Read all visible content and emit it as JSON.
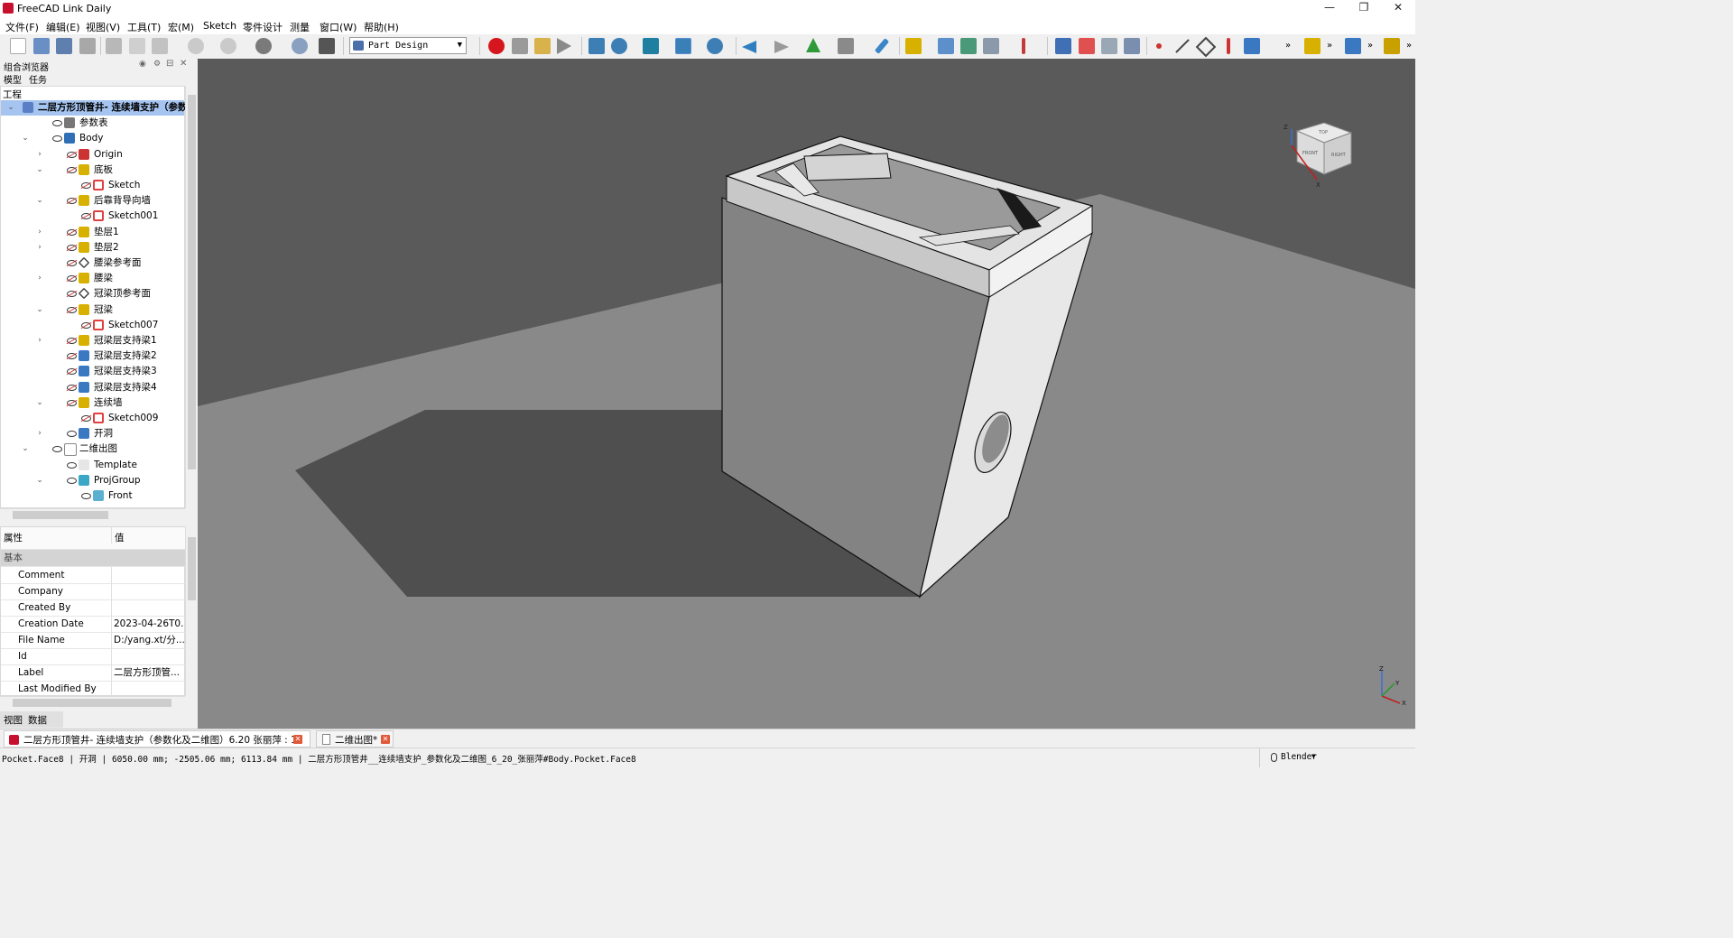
{
  "window": {
    "title": "FreeCAD Link Daily",
    "minimize": "—",
    "restore": "❐",
    "close": "✕"
  },
  "menu": [
    "文件(F)",
    "编辑(E)",
    "视图(V)",
    "工具(T)",
    "宏(M)",
    "Sketch",
    "零件设计",
    "测量",
    "窗口(W)",
    "帮助(H)"
  ],
  "toolbar": {
    "workbench": "Part Design",
    "overflow": "»"
  },
  "left_panel": {
    "title": "组合浏览器",
    "tabs": [
      "模型",
      "任务"
    ],
    "section": "工程",
    "tree": [
      {
        "label": "二层方形顶管井- 连续墙支护（参数化及二维图）",
        "depth": 0,
        "exp": "v",
        "eye": "",
        "icon": "doc",
        "selected": true
      },
      {
        "label": "参数表",
        "depth": 1,
        "exp": "",
        "eye": "show",
        "icon": "sheet"
      },
      {
        "label": "Body",
        "depth": 1,
        "exp": "v",
        "eye": "show",
        "icon": "body"
      },
      {
        "label": "Origin",
        "depth": 2,
        "exp": ">",
        "eye": "hide",
        "icon": "origin"
      },
      {
        "label": "底板",
        "depth": 2,
        "exp": "v",
        "eye": "hide",
        "icon": "pad"
      },
      {
        "label": "Sketch",
        "depth": 3,
        "exp": "",
        "eye": "hide",
        "icon": "sketch"
      },
      {
        "label": "后靠背导向墙",
        "depth": 2,
        "exp": "v",
        "eye": "hide",
        "icon": "pad"
      },
      {
        "label": "Sketch001",
        "depth": 3,
        "exp": "",
        "eye": "hide",
        "icon": "sketch"
      },
      {
        "label": "垫层1",
        "depth": 2,
        "exp": ">",
        "eye": "hide",
        "icon": "pad"
      },
      {
        "label": "垫层2",
        "depth": 2,
        "exp": ">",
        "eye": "hide",
        "icon": "pad"
      },
      {
        "label": "腰梁参考面",
        "depth": 2,
        "exp": "",
        "eye": "hide",
        "icon": "plane"
      },
      {
        "label": "腰梁",
        "depth": 2,
        "exp": ">",
        "eye": "hide",
        "icon": "pad"
      },
      {
        "label": "冠梁顶参考面",
        "depth": 2,
        "exp": "",
        "eye": "hide",
        "icon": "plane"
      },
      {
        "label": "冠梁",
        "depth": 2,
        "exp": "v",
        "eye": "hide",
        "icon": "pad"
      },
      {
        "label": "Sketch007",
        "depth": 3,
        "exp": "",
        "eye": "hide",
        "icon": "sketch"
      },
      {
        "label": "冠梁层支持梁1",
        "depth": 2,
        "exp": ">",
        "eye": "hide",
        "icon": "pad"
      },
      {
        "label": "冠梁层支持梁2",
        "depth": 2,
        "exp": "",
        "eye": "hide",
        "icon": "pattern"
      },
      {
        "label": "冠梁层支持梁3",
        "depth": 2,
        "exp": "",
        "eye": "hide",
        "icon": "pattern"
      },
      {
        "label": "冠梁层支持梁4",
        "depth": 2,
        "exp": "",
        "eye": "hide",
        "icon": "pattern"
      },
      {
        "label": "连续墙",
        "depth": 2,
        "exp": "v",
        "eye": "hide",
        "icon": "pad"
      },
      {
        "label": "Sketch009",
        "depth": 3,
        "exp": "",
        "eye": "hide",
        "icon": "sketch"
      },
      {
        "label": "开洞",
        "depth": 2,
        "exp": ">",
        "eye": "show",
        "icon": "pocket"
      },
      {
        "label": "二维出图",
        "depth": 1,
        "exp": "v",
        "eye": "show",
        "icon": "page"
      },
      {
        "label": "Template",
        "depth": 2,
        "exp": "",
        "eye": "show",
        "icon": "template"
      },
      {
        "label": "ProjGroup",
        "depth": 2,
        "exp": "v",
        "eye": "show",
        "icon": "proj"
      },
      {
        "label": "Front",
        "depth": 3,
        "exp": "",
        "eye": "show",
        "icon": "view"
      }
    ],
    "props_header": {
      "property": "属性",
      "value": "值"
    },
    "props_group": "基本",
    "props": [
      {
        "k": "Comment",
        "v": ""
      },
      {
        "k": "Company",
        "v": ""
      },
      {
        "k": "Created By",
        "v": ""
      },
      {
        "k": "Creation Date",
        "v": "2023-04-26T0..."
      },
      {
        "k": "File Name",
        "v": "D:/yang.xt/分..."
      },
      {
        "k": "Id",
        "v": ""
      },
      {
        "k": "Label",
        "v": "二层方形顶管..."
      },
      {
        "k": "Last Modified By",
        "v": ""
      }
    ],
    "bottom_tabs": [
      "视图",
      "数据"
    ]
  },
  "navcube": {
    "top": "TOP",
    "right": "RIGHT",
    "front": "FRONT",
    "axis_z": "Z",
    "axis_y": "Y",
    "axis_x": "X"
  },
  "doc_tabs": [
    {
      "label": "二层方形顶管井- 连续墙支护（参数化及二维图）6.20 张丽萍 : 1*"
    },
    {
      "label": "二维出图*"
    }
  ],
  "status": {
    "text": "Pocket.Face8 | 开洞 | 6050.00 mm; -2505.06 mm; 6113.84 mm | 二层方形顶管井__连续墙支护_参数化及二维图_6_20_张丽萍#Body.Pocket.Face8",
    "nav_style": "Blender"
  },
  "colors": {
    "selection": "#a6c4f0",
    "viewport_bg": "#5a5a5a",
    "ground": "#8a8a8a",
    "shadow": "#4e4e4e"
  }
}
